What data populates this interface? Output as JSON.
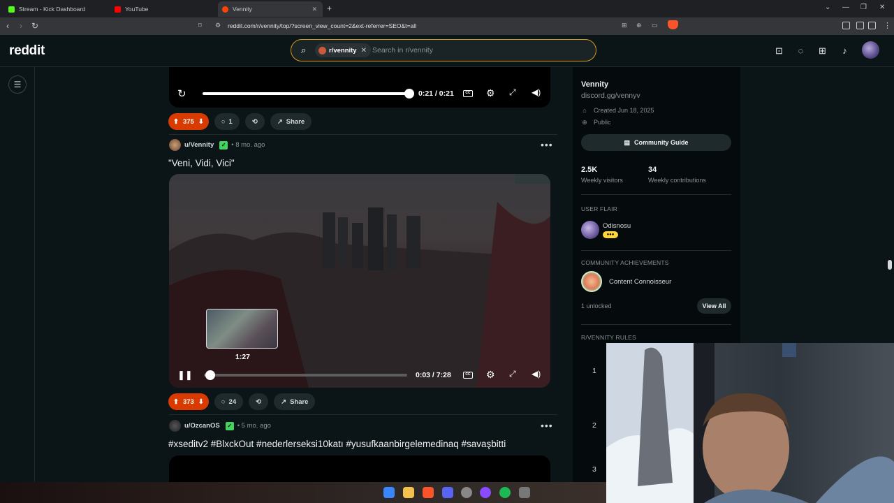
{
  "browser": {
    "tabs": [
      {
        "label": "Stream - Kick Dashboard",
        "color": "#53fc18"
      },
      {
        "label": "YouTube",
        "color": "#ff0000"
      },
      {
        "label": "Vennity",
        "color": "#ff4500"
      }
    ],
    "url": "reddit.com/r/vennity/top/?screen_view_count=2&ext-referrer=SEO&t=all"
  },
  "header": {
    "logo": "reddit",
    "search_chip": "r/vennity",
    "search_placeholder": "Search in r/vennity"
  },
  "post_prev": {
    "time": "0:21 / 0:21",
    "votes": "375",
    "comments": "1",
    "share": "Share"
  },
  "post_main": {
    "author": "u/Vennity",
    "age": "• 8 mo. ago",
    "title": "\"Veni, Vidi, Vici\"",
    "preview_time": "1:27",
    "time": "0:03 / 7:28",
    "progress_fraction": 0.007,
    "votes": "373",
    "comments": "24",
    "share": "Share"
  },
  "post_next": {
    "author": "u/OzcanOS",
    "age": "• 5 mo. ago",
    "title": "#xseditv2 #BlxckOut #nederlerseksi10katı #yusufkaanbirgelemedinaq #savaşbitti"
  },
  "sidebar": {
    "name": "Vennity",
    "link": "discord.gg/vennyv",
    "created": "Created Jun 18, 2025",
    "visibility": "Public",
    "guide_btn": "Community Guide",
    "stat1_value": "2.5K",
    "stat1_label": "Weekly visitors",
    "stat2_value": "34",
    "stat2_label": "Weekly contributions",
    "flair_heading": "USER FLAIR",
    "flair_user": "Odisnosu",
    "ach_heading": "COMMUNITY ACHIEVEMENTS",
    "ach_name": "Content Connoisseur",
    "ach_count": "1 unlocked",
    "view_all": "View All",
    "rules_heading": "R/VENNITY RULES",
    "rules": [
      "1",
      "2",
      "3"
    ]
  },
  "colors": {
    "upvote_bg": "#d93a00",
    "search_border": "#d89a16",
    "page_bg": "#0b1416"
  }
}
